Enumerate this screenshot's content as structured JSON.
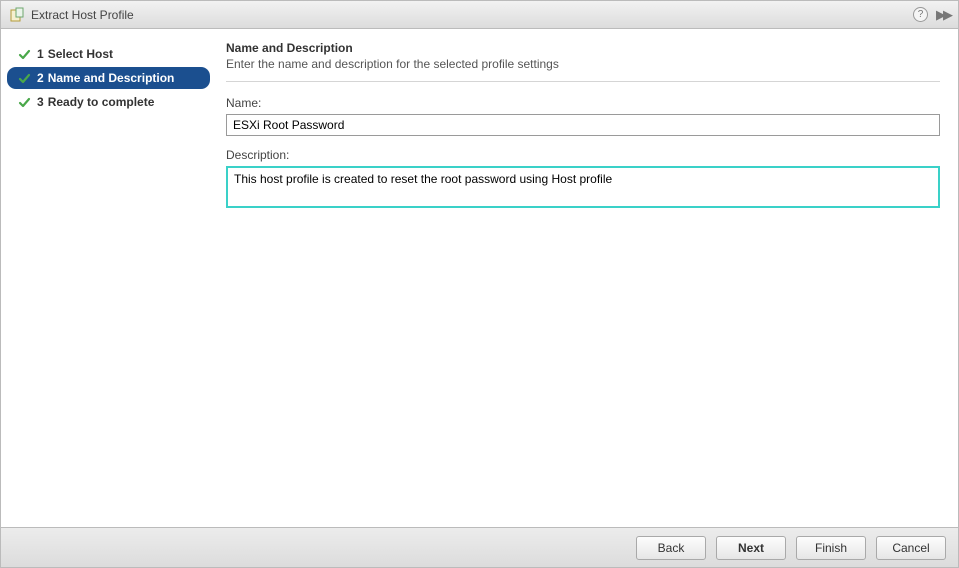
{
  "window": {
    "title": "Extract Host Profile"
  },
  "steps": [
    {
      "num": "1",
      "label": "Select Host"
    },
    {
      "num": "2",
      "label": "Name and Description"
    },
    {
      "num": "3",
      "label": "Ready to complete"
    }
  ],
  "content": {
    "heading": "Name and Description",
    "subheading": "Enter the name and description for the selected profile settings",
    "name_label": "Name:",
    "name_value": "ESXi Root Password",
    "desc_label": "Description:",
    "desc_value": "This host profile is created to reset the root password using Host profile"
  },
  "buttons": {
    "back": "Back",
    "next": "Next",
    "finish": "Finish",
    "cancel": "Cancel"
  }
}
